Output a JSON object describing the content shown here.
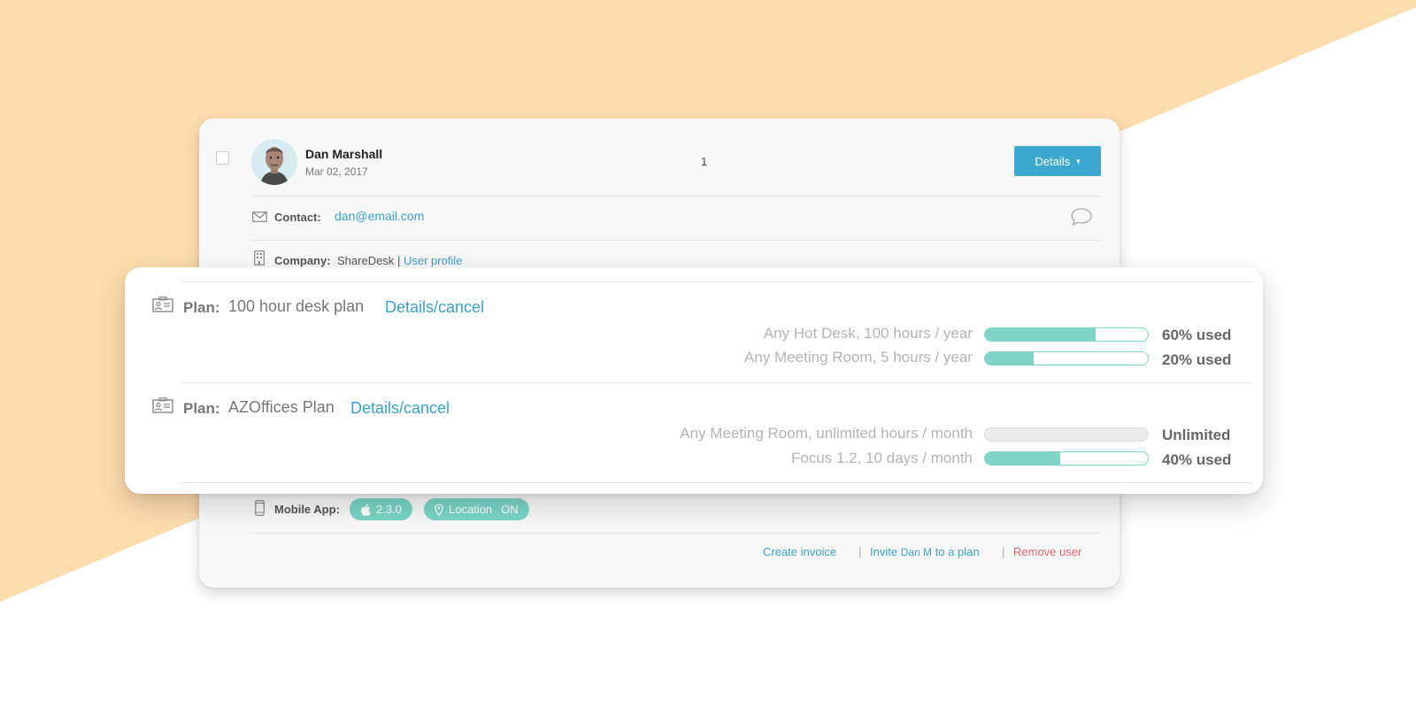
{
  "colors": {
    "accent": "#3da8cf",
    "link": "#3aa1c6",
    "teal": "#7fd4c6",
    "danger": "#e0656b",
    "background_peach": "#fddcae"
  },
  "user": {
    "name": "Dan Marshall",
    "date": "Mar 02, 2017",
    "count": "1"
  },
  "details_button": {
    "label": "Details",
    "caret": "▾"
  },
  "contact": {
    "label": "Contact:",
    "email": "dan@email.com"
  },
  "company": {
    "label": "Company:",
    "name": "ShareDesk",
    "separator": "|",
    "profile_link": "User profile"
  },
  "plans": [
    {
      "label": "Plan:",
      "name": "100 hour desk plan",
      "link": "Details/cancel",
      "usage": [
        {
          "label": "Any Hot Desk, 100 hours / year",
          "fraction": 0.68,
          "value": "60% used"
        },
        {
          "label": "Any Meeting Room, 5 hours / year",
          "fraction": 0.3,
          "value": "20% used"
        }
      ]
    },
    {
      "label": "Plan:",
      "name": "AZOffices Plan",
      "link": "Details/cancel",
      "usage": [
        {
          "label": "Any Meeting Room, unlimited hours / month",
          "fraction": 0,
          "value": "Unlimited",
          "unlimited": true
        },
        {
          "label": "Focus 1.2, 10 days / month",
          "fraction": 0.46,
          "value": "40% used"
        }
      ]
    }
  ],
  "mobile_app": {
    "label": "Mobile App:",
    "badges": [
      {
        "icon": "apple-icon",
        "text": "2.3.0"
      },
      {
        "icon": "location-pin-icon",
        "text": "Location",
        "status": "ON"
      }
    ]
  },
  "footer": {
    "create_invoice": "Create invoice",
    "separator": "|",
    "invite_prefix": "Invite",
    "invite_name": "Dan M",
    "invite_suffix": "to a plan",
    "remove_user": "Remove user"
  }
}
